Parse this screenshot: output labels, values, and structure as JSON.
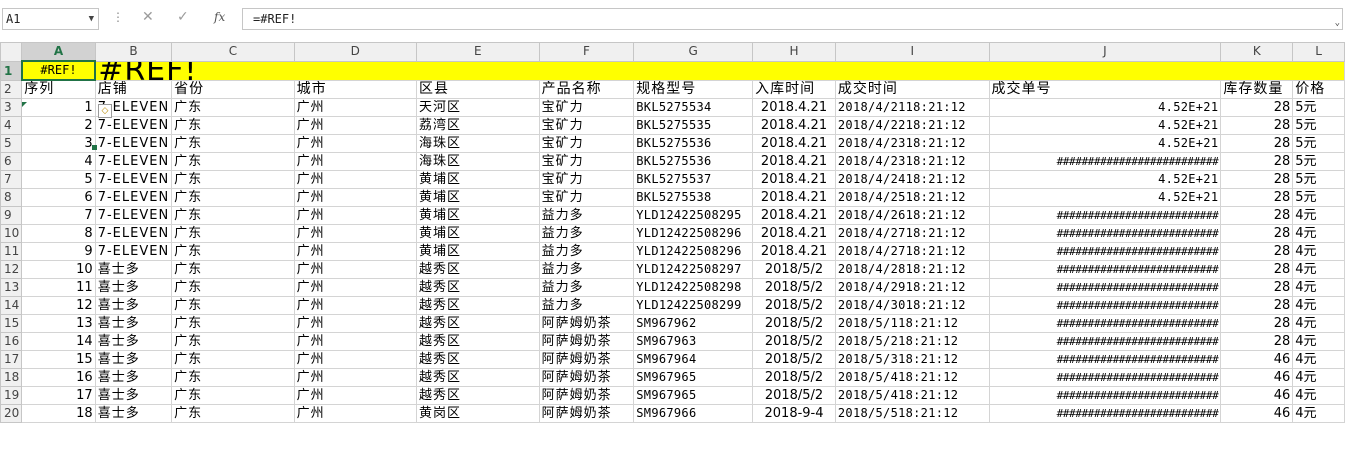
{
  "formula_bar": {
    "name_box": "A1",
    "formula": "=#REF!",
    "cancel_icon": "close-icon",
    "enter_icon": "check-icon",
    "fx_label": "fx"
  },
  "columns": [
    "A",
    "B",
    "C",
    "D",
    "E",
    "F",
    "G",
    "H",
    "I",
    "J",
    "K",
    "L"
  ],
  "sheet": {
    "a1_value": "#REF!",
    "title_value": "#REF!",
    "headers": [
      "序列",
      "店铺",
      "省份",
      "城市",
      "区县",
      "产品名称",
      "规格型号",
      "入库时间",
      "成交时间",
      "成交单号",
      "库存数量",
      "价格"
    ],
    "rows": [
      {
        "n": "3",
        "c": [
          "1",
          "7-ELEVEN",
          "广东",
          "广州",
          "天河区",
          "宝矿力",
          "BKL5275534",
          "2018.4.21",
          "2018/4/2118:21:12",
          "4.52E+21",
          "28",
          "5元"
        ]
      },
      {
        "n": "4",
        "c": [
          "2",
          "7-ELEVEN",
          "广东",
          "广州",
          "荔湾区",
          "宝矿力",
          "BKL5275535",
          "2018.4.21",
          "2018/4/2218:21:12",
          "4.52E+21",
          "28",
          "5元"
        ]
      },
      {
        "n": "5",
        "c": [
          "3",
          "7-ELEVEN",
          "广东",
          "广州",
          "海珠区",
          "宝矿力",
          "BKL5275536",
          "2018.4.21",
          "2018/4/2318:21:12",
          "4.52E+21",
          "28",
          "5元"
        ]
      },
      {
        "n": "6",
        "c": [
          "4",
          "7-ELEVEN",
          "广东",
          "广州",
          "海珠区",
          "宝矿力",
          "BKL5275536",
          "2018.4.21",
          "2018/4/2318:21:12",
          "##########################",
          "28",
          "5元"
        ]
      },
      {
        "n": "7",
        "c": [
          "5",
          "7-ELEVEN",
          "广东",
          "广州",
          "黄埔区",
          "宝矿力",
          "BKL5275537",
          "2018.4.21",
          "2018/4/2418:21:12",
          "4.52E+21",
          "28",
          "5元"
        ]
      },
      {
        "n": "8",
        "c": [
          "6",
          "7-ELEVEN",
          "广东",
          "广州",
          "黄埔区",
          "宝矿力",
          "BKL5275538",
          "2018.4.21",
          "2018/4/2518:21:12",
          "4.52E+21",
          "28",
          "5元"
        ]
      },
      {
        "n": "9",
        "c": [
          "7",
          "7-ELEVEN",
          "广东",
          "广州",
          "黄埔区",
          "益力多",
          "YLD12422508295",
          "2018.4.21",
          "2018/4/2618:21:12",
          "##########################",
          "28",
          "4元"
        ]
      },
      {
        "n": "10",
        "c": [
          "8",
          "7-ELEVEN",
          "广东",
          "广州",
          "黄埔区",
          "益力多",
          "YLD12422508296",
          "2018.4.21",
          "2018/4/2718:21:12",
          "##########################",
          "28",
          "4元"
        ]
      },
      {
        "n": "11",
        "c": [
          "9",
          "7-ELEVEN",
          "广东",
          "广州",
          "黄埔区",
          "益力多",
          "YLD12422508296",
          "2018.4.21",
          "2018/4/2718:21:12",
          "##########################",
          "28",
          "4元"
        ]
      },
      {
        "n": "12",
        "c": [
          "10",
          "喜士多",
          "广东",
          "广州",
          "越秀区",
          "益力多",
          "YLD12422508297",
          "2018/5/2",
          "2018/4/2818:21:12",
          "##########################",
          "28",
          "4元"
        ]
      },
      {
        "n": "13",
        "c": [
          "11",
          "喜士多",
          "广东",
          "广州",
          "越秀区",
          "益力多",
          "YLD12422508298",
          "2018/5/2",
          "2018/4/2918:21:12",
          "##########################",
          "28",
          "4元"
        ]
      },
      {
        "n": "14",
        "c": [
          "12",
          "喜士多",
          "广东",
          "广州",
          "越秀区",
          "益力多",
          "YLD12422508299",
          "2018/5/2",
          "2018/4/3018:21:12",
          "##########################",
          "28",
          "4元"
        ]
      },
      {
        "n": "15",
        "c": [
          "13",
          "喜士多",
          "广东",
          "广州",
          "越秀区",
          "阿萨姆奶茶",
          "SM967962",
          "2018/5/2",
          "2018/5/118:21:12",
          "##########################",
          "28",
          "4元"
        ]
      },
      {
        "n": "16",
        "c": [
          "14",
          "喜士多",
          "广东",
          "广州",
          "越秀区",
          "阿萨姆奶茶",
          "SM967963",
          "2018/5/2",
          "2018/5/218:21:12",
          "##########################",
          "28",
          "4元"
        ]
      },
      {
        "n": "17",
        "c": [
          "15",
          "喜士多",
          "广东",
          "广州",
          "越秀区",
          "阿萨姆奶茶",
          "SM967964",
          "2018/5/2",
          "2018/5/318:21:12",
          "##########################",
          "46",
          "4元"
        ]
      },
      {
        "n": "18",
        "c": [
          "16",
          "喜士多",
          "广东",
          "广州",
          "越秀区",
          "阿萨姆奶茶",
          "SM967965",
          "2018/5/2",
          "2018/5/418:21:12",
          "##########################",
          "46",
          "4元"
        ]
      },
      {
        "n": "19",
        "c": [
          "17",
          "喜士多",
          "广东",
          "广州",
          "越秀区",
          "阿萨姆奶茶",
          "SM967965",
          "2018/5/2",
          "2018/5/418:21:12",
          "##########################",
          "46",
          "4元"
        ]
      },
      {
        "n": "20",
        "c": [
          "18",
          "喜士多",
          "广东",
          "广州",
          "黄岗区",
          "阿萨姆奶茶",
          "SM967966",
          "2018-9-4",
          "2018/5/518:21:12",
          "##########################",
          "46",
          "4元"
        ]
      }
    ]
  },
  "colors": {
    "header_fill": "#ffff00",
    "selection": "#217346"
  }
}
